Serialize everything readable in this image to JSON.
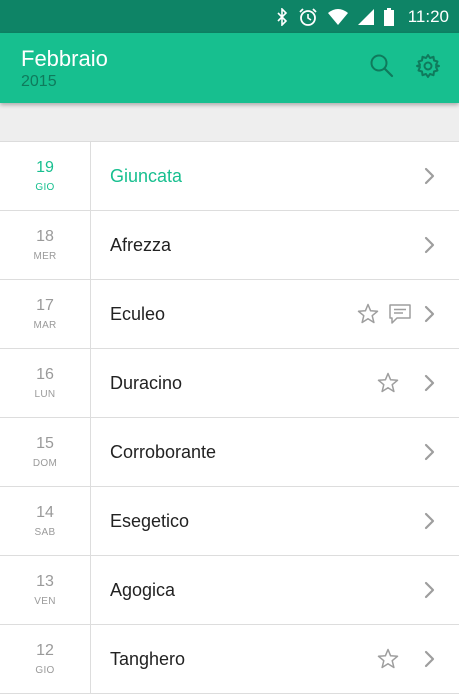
{
  "status_bar": {
    "time": "11:20"
  },
  "app_bar": {
    "title": "Febbraio",
    "subtitle": "2015",
    "actions": [
      "search-icon",
      "gear-icon"
    ]
  },
  "colors": {
    "status_bar": "#0e8466",
    "app_bar": "#17bf8f",
    "accent": "#17bf8f",
    "subtitle": "#0f7a5c"
  },
  "entries": [
    {
      "day": "19",
      "weekday": "GIO",
      "word": "Giuncata",
      "active": true,
      "star": false,
      "comment": false
    },
    {
      "day": "18",
      "weekday": "MER",
      "word": "Afrezza",
      "active": false,
      "star": false,
      "comment": false
    },
    {
      "day": "17",
      "weekday": "MAR",
      "word": "Eculeo",
      "active": false,
      "star": true,
      "comment": true
    },
    {
      "day": "16",
      "weekday": "LUN",
      "word": "Duracino",
      "active": false,
      "star": true,
      "comment": false
    },
    {
      "day": "15",
      "weekday": "DOM",
      "word": "Corroborante",
      "active": false,
      "star": false,
      "comment": false
    },
    {
      "day": "14",
      "weekday": "SAB",
      "word": "Esegetico",
      "active": false,
      "star": false,
      "comment": false
    },
    {
      "day": "13",
      "weekday": "VEN",
      "word": "Agogica",
      "active": false,
      "star": false,
      "comment": false
    },
    {
      "day": "12",
      "weekday": "GIO",
      "word": "Tanghero",
      "active": false,
      "star": true,
      "comment": false
    }
  ]
}
